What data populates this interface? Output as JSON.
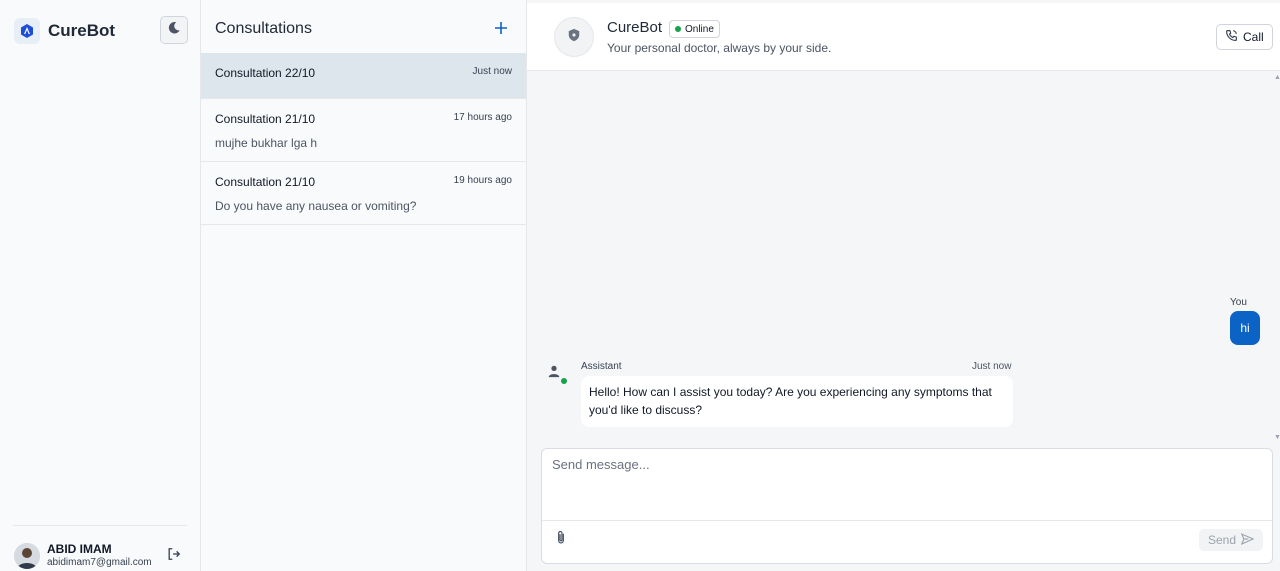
{
  "app": {
    "name": "CureBot"
  },
  "user": {
    "name": "ABID IMAM",
    "email": "abidimam7@gmail.com"
  },
  "consultations": {
    "title": "Consultations",
    "items": [
      {
        "title": "Consultation 22/10",
        "time": "Just now",
        "preview": ""
      },
      {
        "title": "Consultation 21/10",
        "time": "17 hours ago",
        "preview": "mujhe bukhar lga h"
      },
      {
        "title": "Consultation 21/10",
        "time": "19 hours ago",
        "preview": "Do you have any nausea or vomiting?"
      }
    ]
  },
  "chat": {
    "bot_name": "CureBot",
    "status": "Online",
    "subtitle": "Your personal doctor, always by your side.",
    "call_label": "Call",
    "messages": [
      {
        "sender": "You",
        "text": "hi"
      },
      {
        "sender": "Assistant",
        "time": "Just now",
        "text": "Hello! How can I assist you today? Are you experiencing any symptoms that you'd like to discuss?"
      }
    ],
    "composer": {
      "placeholder": "Send message...",
      "send_label": "Send"
    }
  },
  "icons": {
    "brand": "curebot-logo-icon",
    "theme": "moon-icon",
    "logout": "logout-icon",
    "add": "plus-icon",
    "bot": "shield-icon",
    "call": "phone-icon",
    "assistant": "person-icon",
    "attach": "paperclip-icon",
    "send": "send-icon"
  },
  "colors": {
    "accent": "#0b63c6",
    "online": "#16a34a",
    "active_item": "#dde6ec"
  }
}
